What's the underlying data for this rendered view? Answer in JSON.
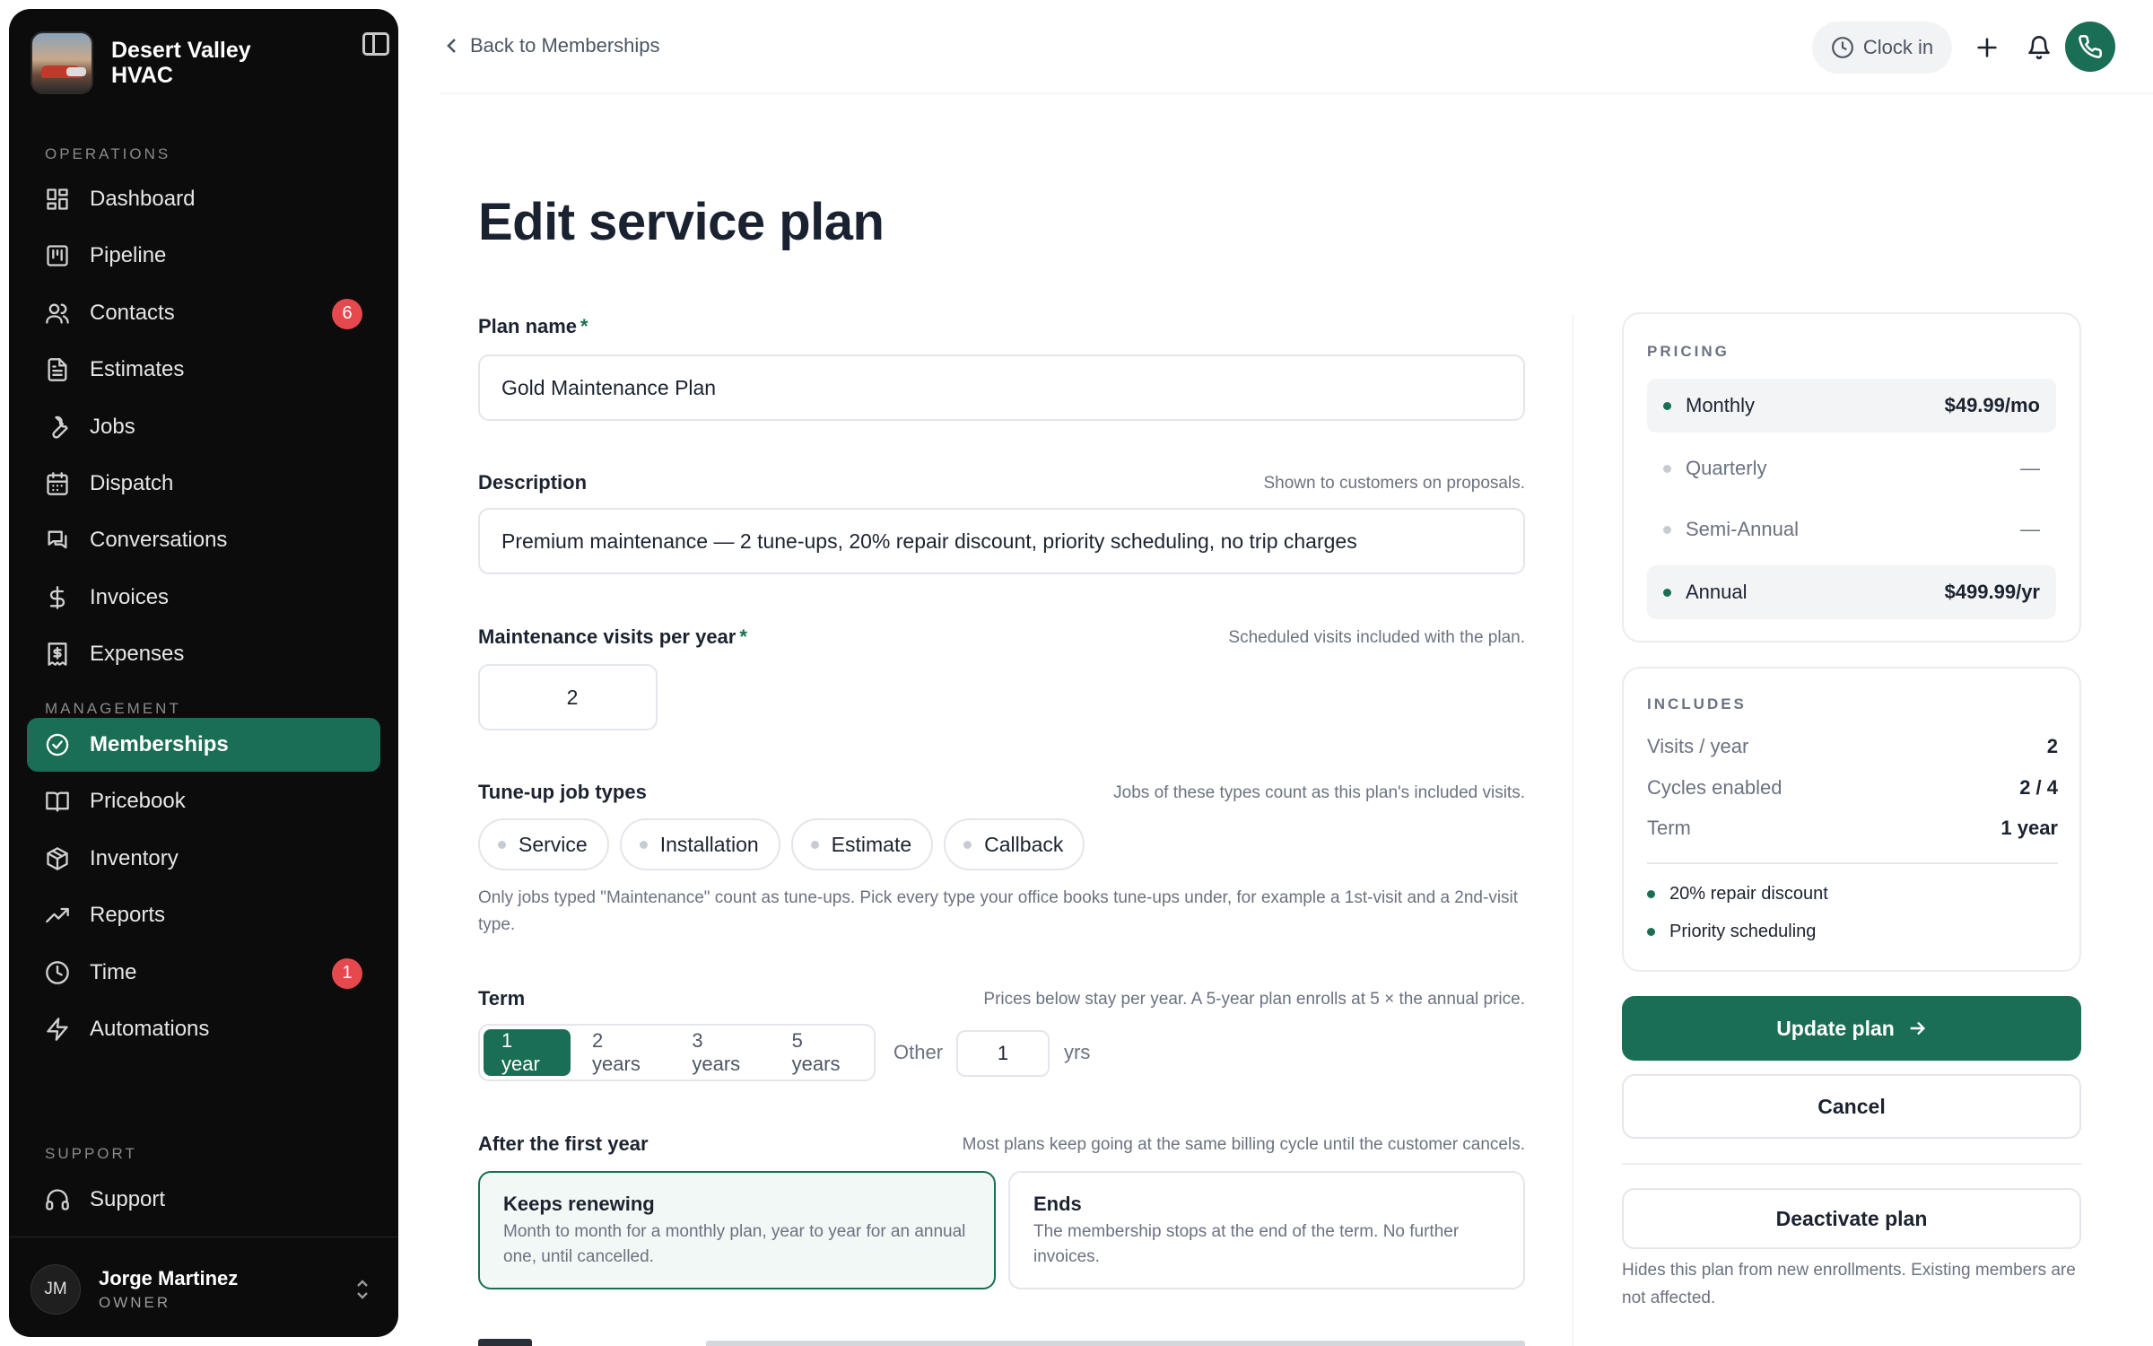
{
  "brand": {
    "name": "Desert Valley HVAC"
  },
  "sidebar": {
    "sections": {
      "operations": "OPERATIONS",
      "management": "MANAGEMENT",
      "support": "SUPPORT"
    },
    "operations_items": [
      {
        "label": "Dashboard",
        "icon": "dashboard-icon"
      },
      {
        "label": "Pipeline",
        "icon": "pipeline-icon"
      },
      {
        "label": "Contacts",
        "icon": "contacts-icon",
        "badge": "6"
      },
      {
        "label": "Estimates",
        "icon": "estimates-icon"
      },
      {
        "label": "Jobs",
        "icon": "wrench-icon"
      },
      {
        "label": "Dispatch",
        "icon": "calendar-icon"
      },
      {
        "label": "Conversations",
        "icon": "chat-icon"
      },
      {
        "label": "Invoices",
        "icon": "dollar-icon"
      },
      {
        "label": "Expenses",
        "icon": "receipt-icon"
      }
    ],
    "management_items": [
      {
        "label": "Memberships",
        "icon": "badge-check-icon",
        "active": true
      },
      {
        "label": "Pricebook",
        "icon": "book-icon"
      },
      {
        "label": "Inventory",
        "icon": "box-icon"
      },
      {
        "label": "Reports",
        "icon": "trend-icon"
      },
      {
        "label": "Time",
        "icon": "clock-icon",
        "badge": "1"
      },
      {
        "label": "Automations",
        "icon": "bolt-icon"
      }
    ],
    "support_items": [
      {
        "label": "Support",
        "icon": "headset-icon"
      }
    ],
    "user": {
      "initials": "JM",
      "name": "Jorge Martinez",
      "role": "OWNER"
    }
  },
  "topbar": {
    "back_label": "Back to Memberships",
    "clock_in_label": "Clock in"
  },
  "form": {
    "title": "Edit service plan",
    "plan_name": {
      "label": "Plan name",
      "required_mark": "*",
      "value": "Gold Maintenance Plan"
    },
    "description": {
      "label": "Description",
      "hint": "Shown to customers on proposals.",
      "value": "Premium maintenance — 2 tune-ups, 20% repair discount, priority scheduling, no trip charges"
    },
    "visits": {
      "label": "Maintenance visits per year",
      "required_mark": "*",
      "hint": "Scheduled visits included with the plan.",
      "value": "2"
    },
    "job_types": {
      "label": "Tune-up job types",
      "hint": "Jobs of these types count as this plan's included visits.",
      "options": [
        "Service",
        "Installation",
        "Estimate",
        "Callback"
      ],
      "help": "Only jobs typed \"Maintenance\" count as tune-ups. Pick every type your office books tune-ups under, for example a 1st-visit and a 2nd-visit type."
    },
    "term": {
      "label": "Term",
      "hint": "Prices below stay per year. A 5-year plan enrolls at 5 × the annual price.",
      "options": [
        "1 year",
        "2 years",
        "3 years",
        "5 years"
      ],
      "selected": "1 year",
      "other_label": "Other",
      "other_value": "1",
      "other_unit": "yrs"
    },
    "after_first_year": {
      "label": "After the first year",
      "hint": "Most plans keep going at the same billing cycle until the customer cancels.",
      "choices": [
        {
          "title": "Keeps renewing",
          "desc": "Month to month for a monthly plan, year to year for an annual one, until cancelled.",
          "selected": true
        },
        {
          "title": "Ends",
          "desc": "The membership stops at the end of the term. No further invoices.",
          "selected": false
        }
      ]
    }
  },
  "pricing": {
    "label": "PRICING",
    "rows": [
      {
        "name": "Monthly",
        "value": "$49.99/mo",
        "enabled": true
      },
      {
        "name": "Quarterly",
        "value": "—",
        "enabled": false
      },
      {
        "name": "Semi-Annual",
        "value": "—",
        "enabled": false
      },
      {
        "name": "Annual",
        "value": "$499.99/yr",
        "enabled": true
      }
    ]
  },
  "includes": {
    "label": "INCLUDES",
    "rows": [
      {
        "name": "Visits / year",
        "value": "2"
      },
      {
        "name": "Cycles enabled",
        "value": "2 / 4"
      },
      {
        "name": "Term",
        "value": "1 year"
      }
    ],
    "perks": [
      "20% repair discount",
      "Priority scheduling"
    ]
  },
  "actions": {
    "update_label": "Update plan",
    "cancel_label": "Cancel",
    "deactivate_label": "Deactivate plan",
    "deactivate_note": "Hides this plan from new enrollments. Existing members are not affected."
  },
  "colors": {
    "accent": "#1a6e55",
    "badge": "#e5484d",
    "sidebar_bg": "#0c0c0c"
  }
}
